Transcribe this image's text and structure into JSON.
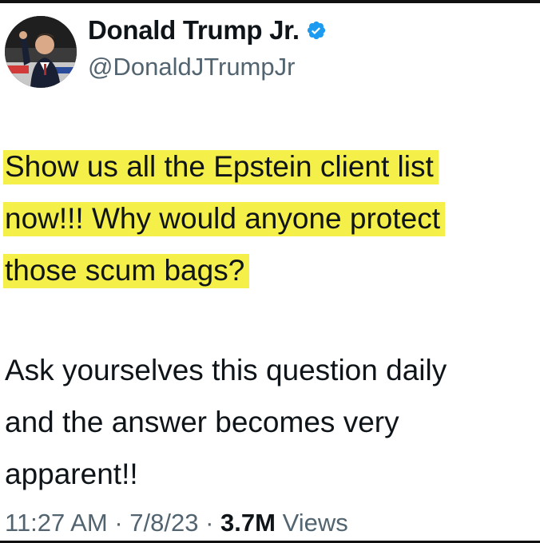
{
  "author": {
    "display_name": "Donald Trump Jr.",
    "handle": "@DonaldJTrumpJr",
    "verified": true,
    "verified_color": "#1d9bf0"
  },
  "tweet": {
    "highlighted_lines": [
      "Show us all the Epstein client list",
      "now!!! Why would anyone protect",
      "those scum bags?"
    ],
    "paragraph_2_lines": [
      "Ask yourselves this question daily",
      "and the answer becomes very",
      "apparent!!"
    ],
    "highlight_color": "#f5ef4a"
  },
  "meta": {
    "time": "11:27 AM",
    "separator": "·",
    "date": "7/8/23",
    "views_count": "3.7M",
    "views_label": "Views"
  }
}
